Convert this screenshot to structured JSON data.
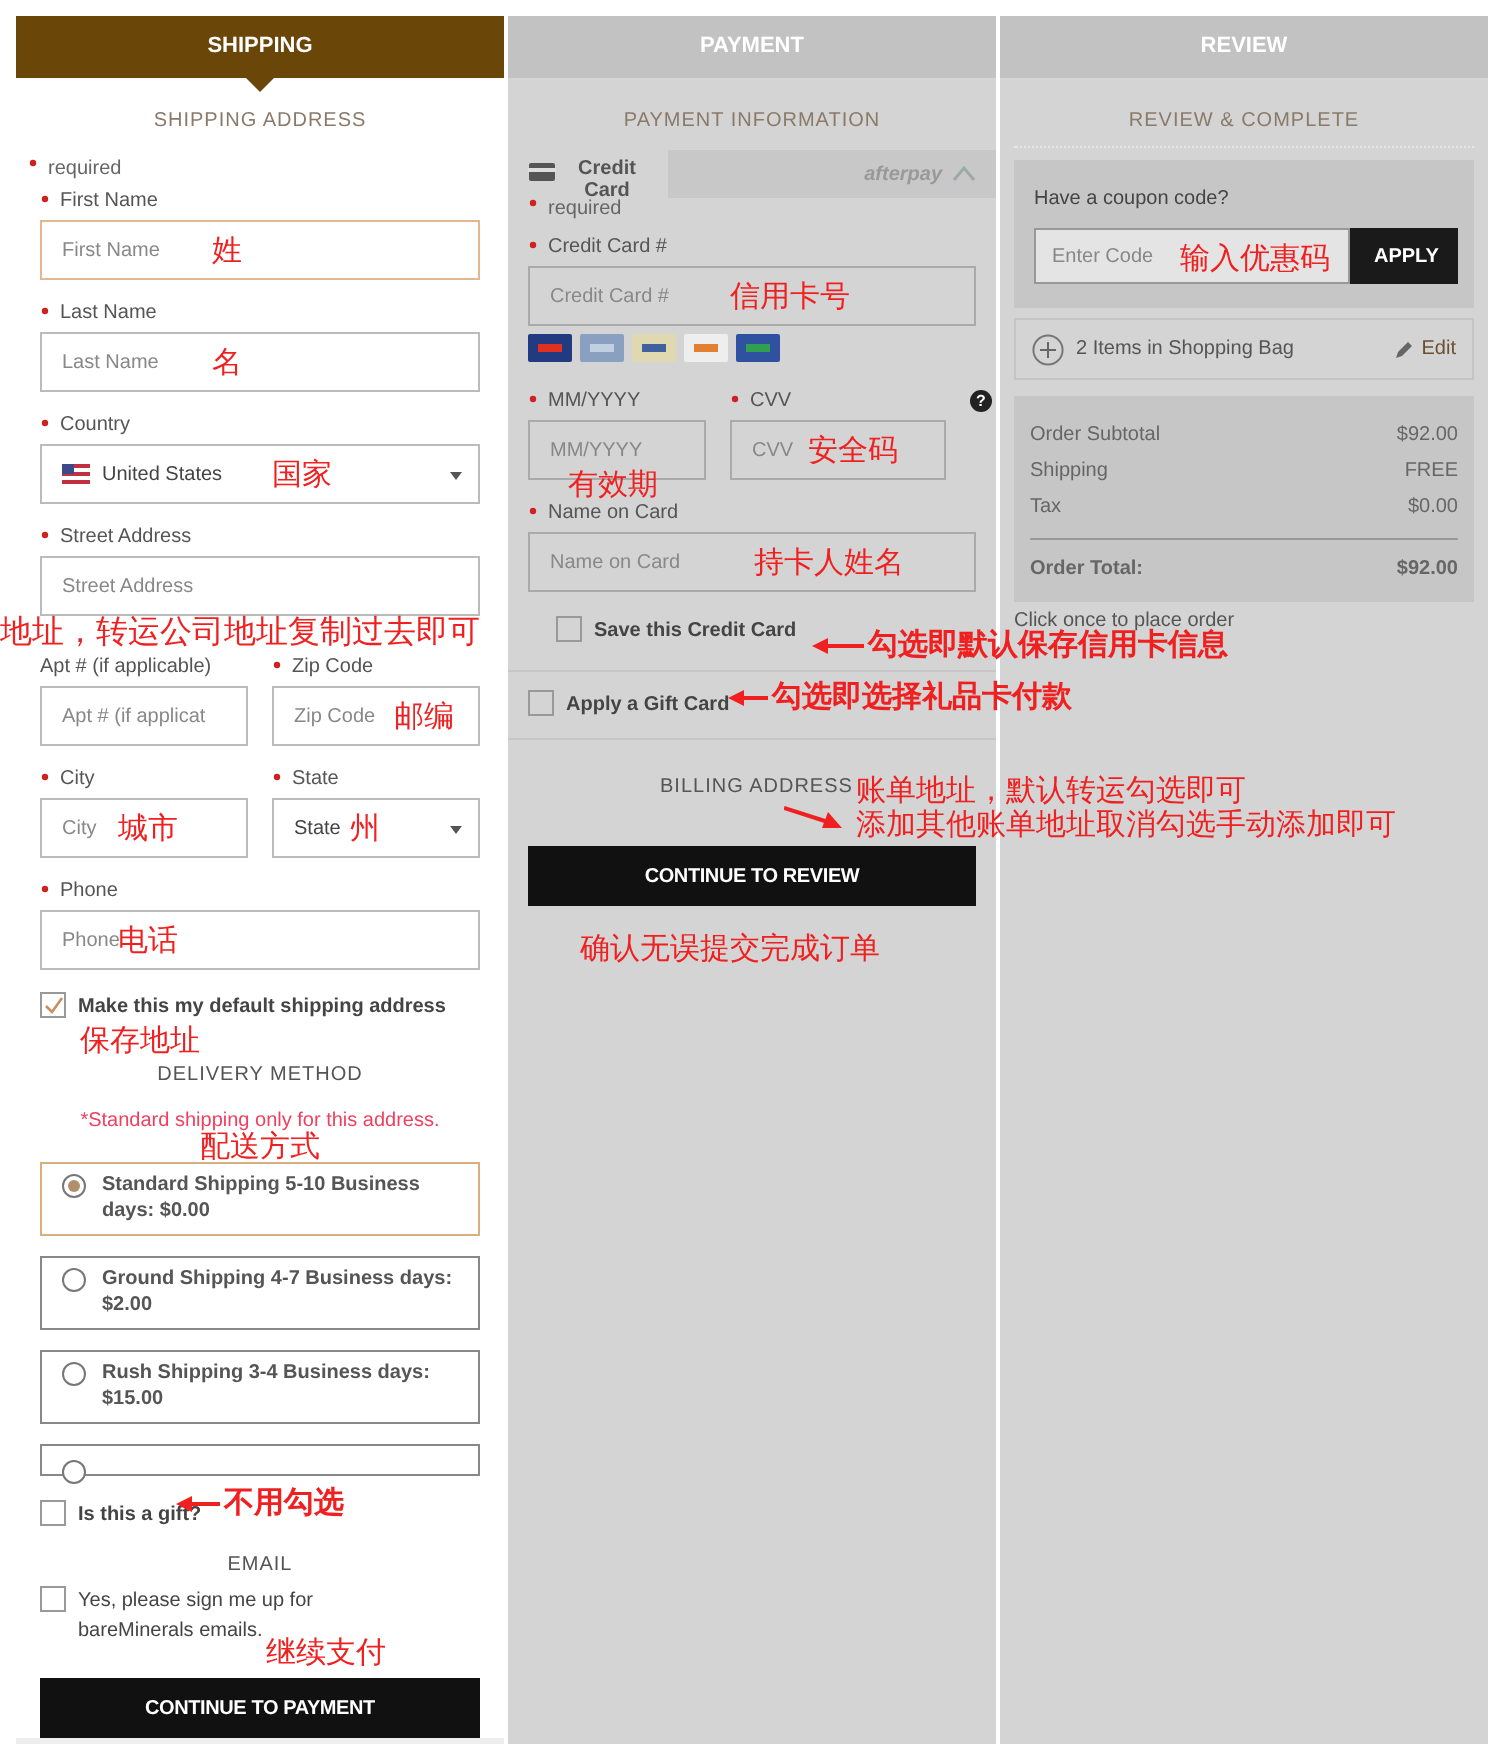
{
  "steps": [
    {
      "label": "SHIPPING",
      "selected": true
    },
    {
      "label": "PAYMENT",
      "selected": false
    },
    {
      "label": "REVIEW",
      "selected": false
    }
  ],
  "shipping": {
    "heading": "SHIPPING ADDRESS",
    "required_note": "required",
    "rows": [
      [
        {
          "kind": "text",
          "label": "First Name",
          "required": true,
          "placeholder": "First Name",
          "focused": true,
          "note": "姓"
        }
      ],
      [
        {
          "kind": "text",
          "label": "Last Name",
          "required": true,
          "placeholder": "Last Name",
          "note": "名"
        }
      ],
      [
        {
          "kind": "country",
          "label": "Country",
          "required": true,
          "value": "United States",
          "note": "国家"
        }
      ],
      [
        {
          "kind": "text",
          "label": "Street Address",
          "required": true,
          "placeholder": "Street Address",
          "note_below": "地址，转运公司地址复制过去即可"
        }
      ],
      [
        {
          "kind": "text",
          "label": "Apt # (if applicable)",
          "required": false,
          "placeholder": "Apt # (if applicat"
        },
        {
          "kind": "text",
          "label": "Zip Code",
          "required": true,
          "placeholder": "Zip Code",
          "note": "邮编"
        }
      ],
      [
        {
          "kind": "text",
          "label": "City",
          "required": true,
          "placeholder": "City",
          "note": "城市"
        },
        {
          "kind": "select",
          "label": "State",
          "required": true,
          "value": "State",
          "note": "州"
        }
      ],
      [
        {
          "kind": "text",
          "label": "Phone",
          "required": true,
          "placeholder": "Phone",
          "note": "电话"
        }
      ]
    ],
    "default_address": {
      "label": "Make this my default shipping address",
      "checked": true,
      "note": "保存地址"
    },
    "delivery": {
      "heading": "DELIVERY METHOD",
      "warning": "*Standard shipping only for this address.",
      "note": "配送方式",
      "options": [
        {
          "label": "Standard Shipping 5-10 Business days: $0.00",
          "selected": true
        },
        {
          "label": "Ground Shipping 4-7 Business days: $2.00",
          "selected": false
        },
        {
          "label": "Rush Shipping 3-4 Business days: $15.00",
          "selected": false
        },
        {
          "selected": false
        }
      ]
    },
    "gift": {
      "label": "Is this a gift?",
      "checked": false,
      "note": "不用勾选"
    },
    "email": {
      "heading": "EMAIL",
      "label": "Yes, please sign me up for bareMinerals emails.",
      "checked": false
    },
    "button_note": "继续支付",
    "button": "CONTINUE TO PAYMENT"
  },
  "payment": {
    "heading": "PAYMENT INFORMATION",
    "tabs": [
      {
        "label": "Credit Card",
        "kind": "card",
        "selected": true
      },
      {
        "label": "afterpay",
        "kind": "afterpay",
        "selected": false
      }
    ],
    "required_note": "required",
    "card_number": {
      "label": "Credit Card #",
      "placeholder": "Credit Card #",
      "note": "信用卡号"
    },
    "expiry": {
      "label": "MM/YYYY",
      "placeholder": "MM/YYYY",
      "note": "有效期"
    },
    "cvv": {
      "label": "CVV",
      "placeholder": "CVV",
      "note": "安全码",
      "help": "?"
    },
    "name": {
      "label": "Name on Card",
      "placeholder": "Name on Card",
      "note": "持卡人姓名"
    },
    "save_card": {
      "label": "Save this Credit Card",
      "checked": false,
      "note": "勾选即默认保存信用卡信息"
    },
    "gift_card": {
      "label": "Apply a Gift Card",
      "checked": false,
      "note": "勾选即选择礼品卡付款"
    },
    "billing": {
      "heading": "BILLING ADDRESS",
      "notes": [
        "账单地址，默认转运勾选即可",
        "添加其他账单地址取消勾选手动添加即可"
      ]
    },
    "button": "CONTINUE TO REVIEW",
    "button_note": "确认无误提交完成订单"
  },
  "review": {
    "heading": "REVIEW & COMPLETE",
    "coupon": {
      "label": "Have a coupon code?",
      "placeholder": "Enter Code",
      "note": "输入优惠码",
      "button": "APPLY"
    },
    "bag": {
      "label": "2 Items in Shopping Bag",
      "edit": "Edit"
    },
    "summary": [
      {
        "label": "Order Subtotal",
        "value": "$92.00"
      },
      {
        "label": "Shipping",
        "value": "FREE"
      },
      {
        "label": "Tax",
        "value": "$0.00"
      }
    ],
    "total": {
      "label": "Order Total:",
      "value": "$92.00"
    },
    "footnote": "Click once to place order"
  }
}
